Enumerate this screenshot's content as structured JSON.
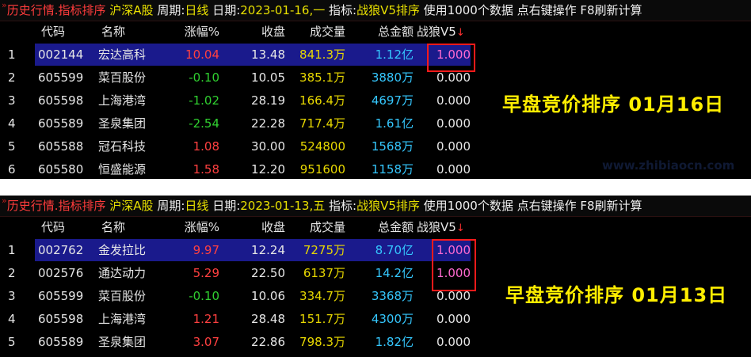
{
  "panels": [
    {
      "title": {
        "prefix": "历史行情.指标排序",
        "market": "沪深A股",
        "period_label": "周期:",
        "period_value": "日线",
        "date_label": "日期:",
        "date_value": "2023-01-16,一",
        "indicator_label": "指标:",
        "indicator_value": "战狼V5排序",
        "info": "使用1000个数据 点右键操作 F8刷新计算"
      },
      "headers": [
        "代码",
        "名称",
        "涨幅%",
        "收盘",
        "成交量",
        "总金额",
        "战狼V5"
      ],
      "rows": [
        {
          "idx": "1",
          "code": "002144",
          "name": "宏达高科",
          "chg": "10.04",
          "close": "13.48",
          "vol": "841.3万",
          "amt": "1.12亿",
          "zl": "1.000"
        },
        {
          "idx": "2",
          "code": "605599",
          "name": "菜百股份",
          "chg": "-0.10",
          "close": "10.05",
          "vol": "385.1万",
          "amt": "3880万",
          "zl": "0.000"
        },
        {
          "idx": "3",
          "code": "605598",
          "name": "上海港湾",
          "chg": "-1.02",
          "close": "28.19",
          "vol": "166.4万",
          "amt": "4697万",
          "zl": "0.000"
        },
        {
          "idx": "4",
          "code": "605589",
          "name": "圣泉集团",
          "chg": "-2.54",
          "close": "22.28",
          "vol": "717.4万",
          "amt": "1.61亿",
          "zl": "0.000"
        },
        {
          "idx": "5",
          "code": "605588",
          "name": "冠石科技",
          "chg": "1.08",
          "close": "30.00",
          "vol": "524800",
          "amt": "1568万",
          "zl": "0.000"
        },
        {
          "idx": "6",
          "code": "605580",
          "name": "恒盛能源",
          "chg": "1.58",
          "close": "12.20",
          "vol": "951600",
          "amt": "1158万",
          "zl": "0.000"
        }
      ],
      "caption": "早盘竞价排序  01月16日",
      "watermark": "www.zhibiaocn.com"
    },
    {
      "title": {
        "prefix": "历史行情.指标排序",
        "market": "沪深A股",
        "period_label": "周期:",
        "period_value": "日线",
        "date_label": "日期:",
        "date_value": "2023-01-13,五",
        "indicator_label": "指标:",
        "indicator_value": "战狼V5排序",
        "info": "使用1000个数据 点右键操作 F8刷新计算"
      },
      "headers": [
        "代码",
        "名称",
        "涨幅%",
        "收盘",
        "成交量",
        "总金额",
        "战狼V5"
      ],
      "rows": [
        {
          "idx": "1",
          "code": "002762",
          "name": "金发拉比",
          "chg": "9.97",
          "close": "12.24",
          "vol": "7275万",
          "amt": "8.70亿",
          "zl": "1.000"
        },
        {
          "idx": "2",
          "code": "002576",
          "name": "通达动力",
          "chg": "5.29",
          "close": "22.50",
          "vol": "6137万",
          "amt": "14.2亿",
          "zl": "1.000"
        },
        {
          "idx": "3",
          "code": "605599",
          "name": "菜百股份",
          "chg": "-0.10",
          "close": "10.06",
          "vol": "334.7万",
          "amt": "3368万",
          "zl": "0.000"
        },
        {
          "idx": "4",
          "code": "605598",
          "name": "上海港湾",
          "chg": "1.21",
          "close": "28.48",
          "vol": "151.7万",
          "amt": "4300万",
          "zl": "0.000"
        },
        {
          "idx": "5",
          "code": "605589",
          "name": "圣泉集团",
          "chg": "3.07",
          "close": "22.86",
          "vol": "798.3万",
          "amt": "1.82亿",
          "zl": "0.000"
        }
      ],
      "caption": "早盘竞价排序  01月13日"
    }
  ],
  "sort_arrow": "↓",
  "colors": {
    "up": "#ff4040",
    "down": "#30d030",
    "volume": "#e8d800",
    "amount": "#35c8ff",
    "selected_row": "#1a1a8c",
    "highlight_box": "#ff1a1a",
    "caption": "#ffee00"
  }
}
